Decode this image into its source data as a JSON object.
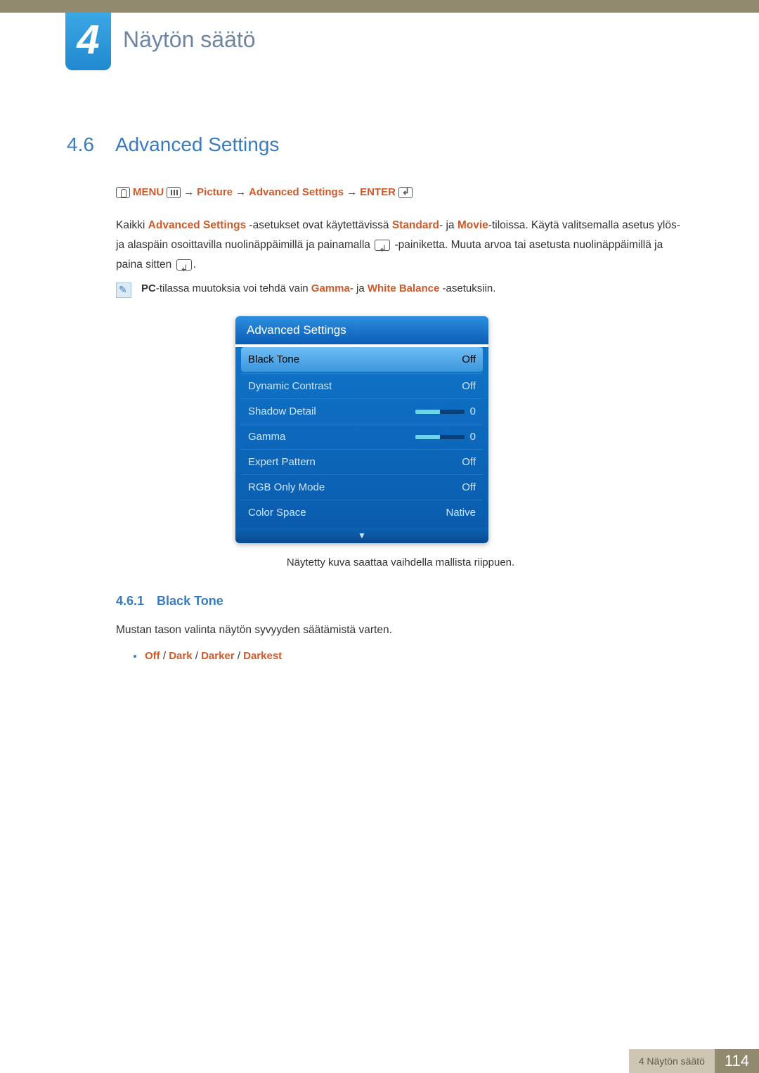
{
  "chapter": {
    "number": "4",
    "title": "Näytön säätö"
  },
  "section": {
    "number": "4.6",
    "title": "Advanced Settings"
  },
  "breadcrumb": {
    "menu": "MENU",
    "picture": "Picture",
    "advanced": "Advanced Settings",
    "enter": "ENTER"
  },
  "paragraph": {
    "p1a": "Kaikki ",
    "p1b": "Advanced Settings",
    "p1c": " -asetukset ovat käytettävissä ",
    "p1d": "Standard",
    "p1e": "- ja ",
    "p1f": "Movie",
    "p1g": "-tiloissa. Käytä valitsemalla asetus ylös- ja alaspäin osoittavilla nuolinäppäimillä ja painamalla ",
    "p1h": " -painiketta. Muuta arvoa tai asetusta nuolinäppäimillä ja paina sitten ",
    "p1i": "."
  },
  "note": {
    "a": "PC",
    "b": "-tilassa muutoksia voi tehdä vain ",
    "c": "Gamma",
    "d": "- ja ",
    "e": "White Balance",
    "f": " -asetuksiin."
  },
  "osd": {
    "title": "Advanced Settings",
    "rows": [
      {
        "label": "Black Tone",
        "value": "Off",
        "type": "text",
        "selected": true
      },
      {
        "label": "Dynamic Contrast",
        "value": "Off",
        "type": "text"
      },
      {
        "label": "Shadow Detail",
        "value": "0",
        "type": "slider"
      },
      {
        "label": "Gamma",
        "value": "0",
        "type": "slider"
      },
      {
        "label": "Expert Pattern",
        "value": "Off",
        "type": "text"
      },
      {
        "label": "RGB Only Mode",
        "value": "Off",
        "type": "text"
      },
      {
        "label": "Color Space",
        "value": "Native",
        "type": "text"
      }
    ],
    "footer_arrow": "▼"
  },
  "caption": "Näytetty kuva saattaa vaihdella mallista riippuen.",
  "subsection": {
    "number": "4.6.1",
    "title": "Black Tone"
  },
  "sub_desc": "Mustan tason valinta näytön syvyyden säätämistä varten.",
  "options": {
    "o1": "Off",
    "o2": "Dark",
    "o3": "Darker",
    "o4": "Darkest",
    "sep": " / "
  },
  "footer": {
    "label": "4 Näytön säätö",
    "page": "114"
  }
}
